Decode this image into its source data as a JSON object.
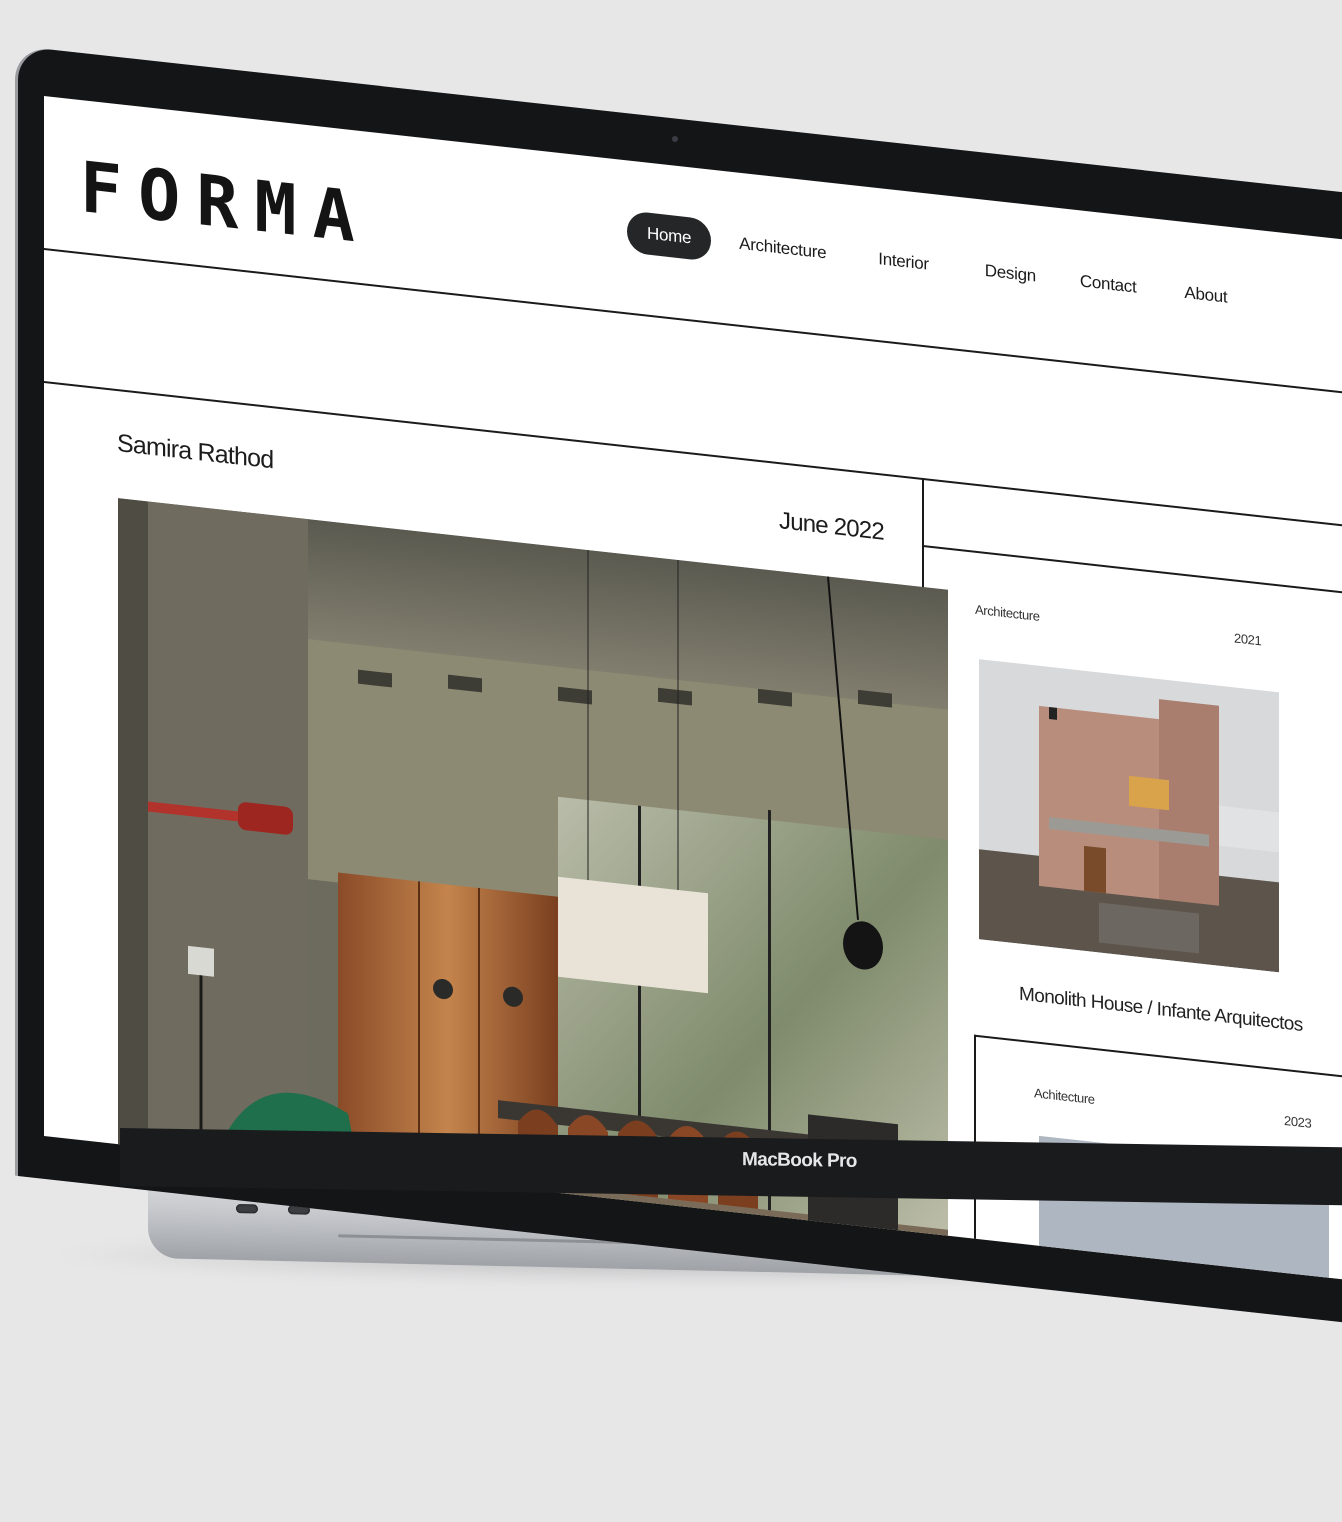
{
  "site": {
    "logo": "FORMA",
    "nav": [
      {
        "label": "Home",
        "active": true
      },
      {
        "label": "Architecture",
        "active": false
      },
      {
        "label": "Interior",
        "active": false
      },
      {
        "label": "Design",
        "active": false
      },
      {
        "label": "Contact",
        "active": false
      },
      {
        "label": "About",
        "active": false
      }
    ]
  },
  "article": {
    "author": "Samira Rathod",
    "date": "June 2022",
    "hero_image": "interior-living-room-photo"
  },
  "sidebar": {
    "cards": [
      {
        "category": "Architecture",
        "year": "2021",
        "title": "Monolith House / Infante Arquitectos",
        "image": "pink-concrete-house-photo"
      },
      {
        "category": "Achitecture",
        "year": "2023",
        "title": "",
        "image": "sky-photo"
      }
    ]
  },
  "device": {
    "label": "MacBook Pro"
  },
  "colors": {
    "background": "#e7e7e8",
    "bezel": "#141516",
    "nav_active_bg": "#252627",
    "text": "#1c1c1c",
    "rule": "#1a1a1a"
  }
}
